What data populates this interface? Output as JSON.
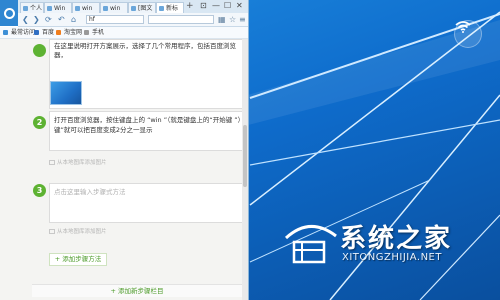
{
  "browser": {
    "tabs": [
      {
        "label": "个人"
      },
      {
        "label": "Win"
      },
      {
        "label": "win"
      },
      {
        "label": "win"
      },
      {
        "label": "[图文"
      },
      {
        "label": "新标"
      }
    ],
    "new_tab": "+",
    "window_controls": {
      "pin": "⊡",
      "minimize": "—",
      "maximize": "☐",
      "close": "✕"
    },
    "nav": {
      "back": "❮",
      "forward": "❯",
      "refresh": "⟳",
      "undo": "↶",
      "home": "⌂"
    },
    "address": "hf",
    "search_placeholder": "",
    "bookmarks": [
      {
        "label": "最常访问"
      },
      {
        "label": "百度"
      },
      {
        "label": "淘宝网"
      },
      {
        "label": "手机"
      }
    ]
  },
  "article": {
    "step1": {
      "text": "在这里说明打开方案展示，选择了几个常用程序，包括百度浏览器，"
    },
    "step2": {
      "number": "2",
      "line1": "打开百度浏览器，按住键盘上的 “win ”（就是键盘上的“开始键 ”）",
      "line2": "键”就可以把百度变成2分之一显示",
      "image_hint": "从本地图库添加图片"
    },
    "step3": {
      "number": "3",
      "placeholder": "点击这里输入步骤式方法",
      "image_hint": "从本地图库添加图片"
    },
    "add_method": "+ 添加步骤方法",
    "add_section": "+ 添加新步骤栏目"
  },
  "watermark": {
    "name": "系统之家",
    "url": "XITONGZHIJIA.NET"
  },
  "colors": {
    "step_green": "#5db232",
    "desktop_blue": "#0e6ccc"
  }
}
